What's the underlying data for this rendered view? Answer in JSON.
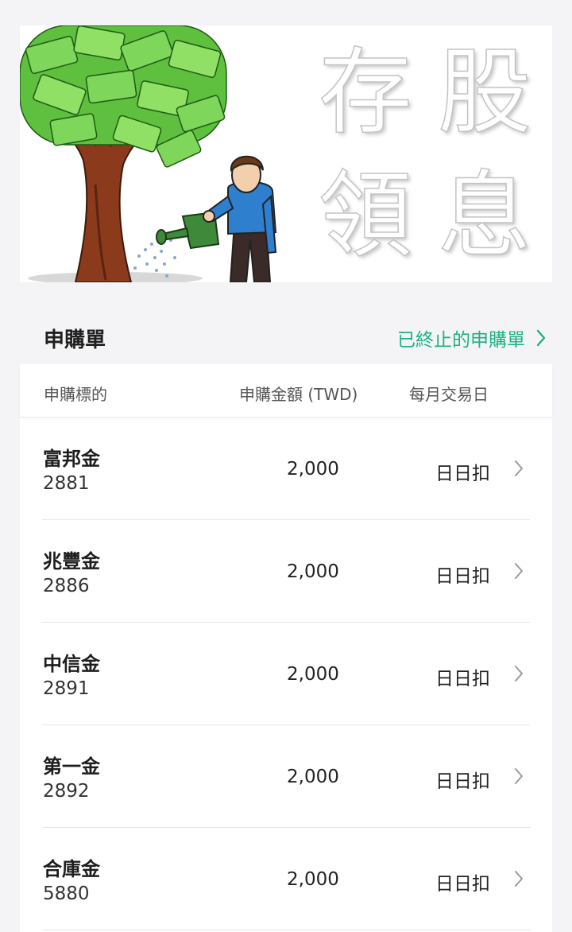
{
  "banner": {
    "chars": [
      "存",
      "股",
      "領",
      "息"
    ]
  },
  "section": {
    "title": "申購單",
    "stopped_link": "已終止的申購單"
  },
  "columns": {
    "target": "申購標的",
    "amount": "申購金額 (TWD)",
    "trade_day": "每月交易日"
  },
  "rows": [
    {
      "name": "富邦金",
      "code": "2881",
      "amount": "2,000",
      "frequency": "日日扣"
    },
    {
      "name": "兆豐金",
      "code": "2886",
      "amount": "2,000",
      "frequency": "日日扣"
    },
    {
      "name": "中信金",
      "code": "2891",
      "amount": "2,000",
      "frequency": "日日扣"
    },
    {
      "name": "第一金",
      "code": "2892",
      "amount": "2,000",
      "frequency": "日日扣"
    },
    {
      "name": "合庫金",
      "code": "5880",
      "amount": "2,000",
      "frequency": "日日扣"
    }
  ],
  "colors": {
    "accent": "#1db185",
    "background": "#f4f4f6",
    "card": "#ffffff"
  }
}
